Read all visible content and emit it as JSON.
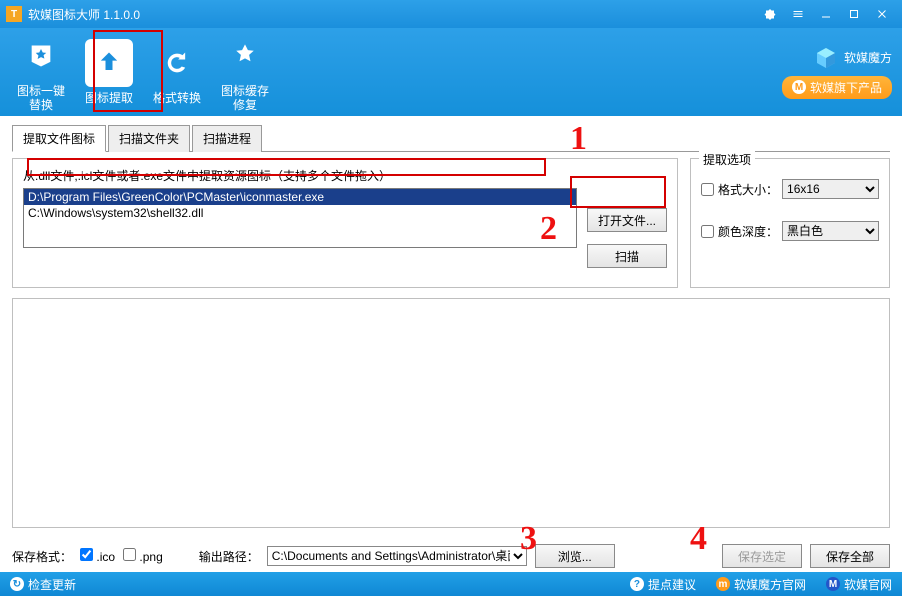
{
  "window": {
    "title": "软媒图标大师 1.1.0.0"
  },
  "toolbar": {
    "items": [
      {
        "label": "图标一键\n替换"
      },
      {
        "label": "图标提取"
      },
      {
        "label": "格式转换"
      },
      {
        "label": "图标缓存\n修复"
      }
    ],
    "brand": "软媒魔方",
    "prod_button": "软媒旗下产品"
  },
  "tabs": [
    {
      "label": "提取文件图标"
    },
    {
      "label": "扫描文件夹"
    },
    {
      "label": "扫描进程"
    }
  ],
  "extract": {
    "hint": "从.dll文件,.icl文件或者.exe文件中提取资源图标（支持多个文件拖入）",
    "files": [
      "D:\\Program Files\\GreenColor\\PCMaster\\iconmaster.exe",
      "C:\\Windows\\system32\\shell32.dll"
    ],
    "selected_index": 0,
    "open_btn": "打开文件...",
    "scan_btn": "扫描"
  },
  "options": {
    "group_title": "提取选项",
    "size_label": "格式大小：",
    "size_value": "16x16",
    "depth_label": "颜色深度：",
    "depth_value": "黑白色"
  },
  "bottom": {
    "save_fmt_label": "保存格式：",
    "ico_label": ".ico",
    "png_label": ".png",
    "out_path_label": "输出路径：",
    "out_path_value": "C:\\Documents and Settings\\Administrator\\桌面",
    "browse_btn": "浏览...",
    "save_sel_btn": "保存选定",
    "save_all_btn": "保存全部"
  },
  "status": {
    "check_update": "检查更新",
    "suggest": "提点建议",
    "ruanmei_cube": "软媒魔方官网",
    "ruanmei": "软媒官网"
  },
  "annotations": {
    "n1": "1",
    "n2": "2",
    "n3": "3",
    "n4": "4"
  }
}
